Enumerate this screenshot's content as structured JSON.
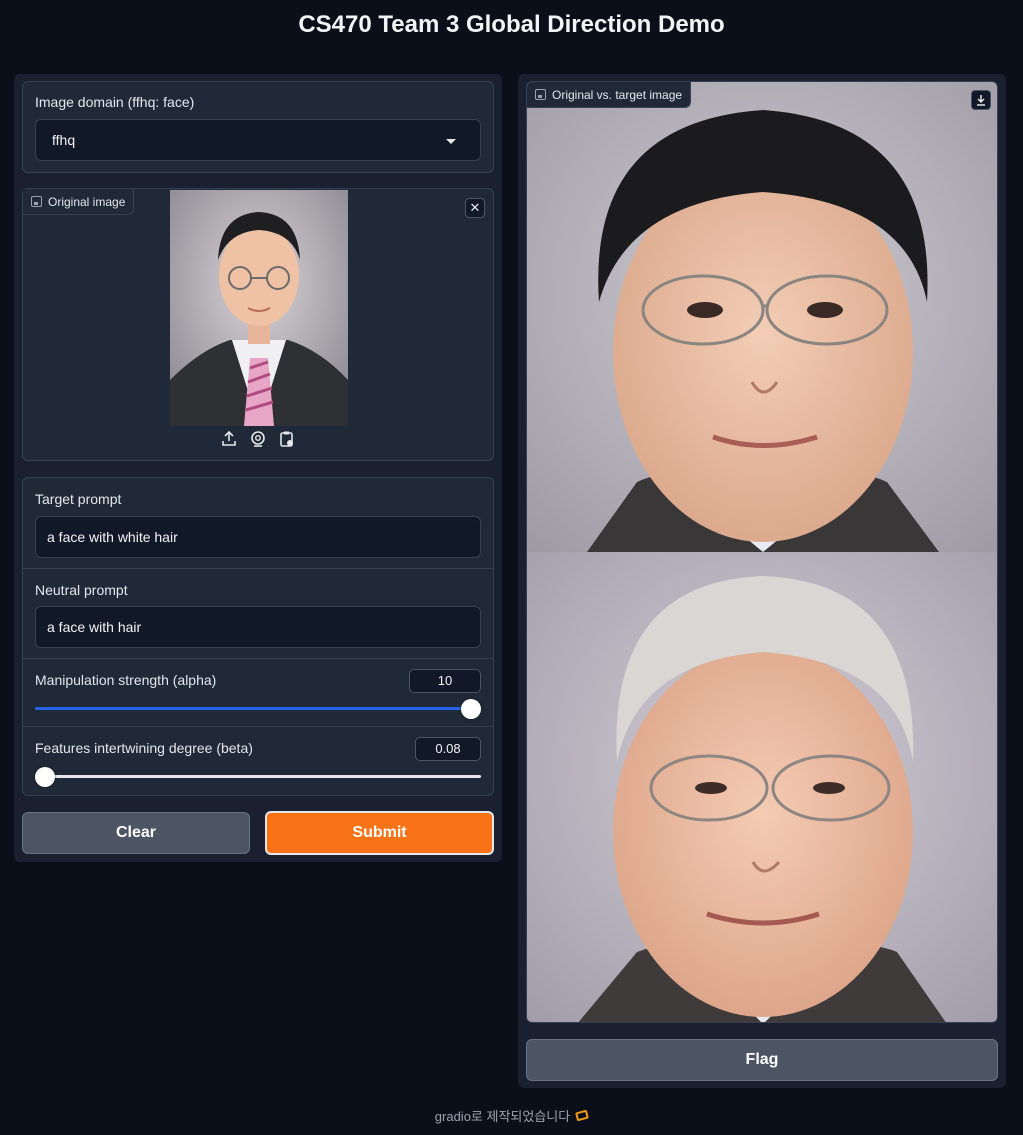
{
  "app": {
    "title": "CS470 Team 3 Global Direction Demo"
  },
  "domain_select": {
    "label": "Image domain (ffhq: face)",
    "value": "ffhq"
  },
  "original_image": {
    "tag": "Original image"
  },
  "target_prompt": {
    "label": "Target prompt",
    "value": "a face with white hair"
  },
  "neutral_prompt": {
    "label": "Neutral prompt",
    "value": "a face with hair"
  },
  "alpha": {
    "label": "Manipulation strength (alpha)",
    "value": "10",
    "fraction": 1.0
  },
  "beta": {
    "label": "Features intertwining degree (beta)",
    "value": "0.08",
    "fraction": 0.0
  },
  "buttons": {
    "clear": "Clear",
    "submit": "Submit",
    "flag": "Flag"
  },
  "output_image": {
    "tag": "Original vs. target image"
  },
  "footer": {
    "text": "gradio로 제작되었습니다"
  },
  "colors": {
    "accent": "#f97316",
    "slider_fill": "#2563eb",
    "background": "#0b0f19"
  },
  "icons": [
    "image-icon",
    "close-icon",
    "upload-icon",
    "webcam-icon",
    "clipboard-icon",
    "download-icon",
    "gradio-logo-icon",
    "chevron-down-icon"
  ]
}
